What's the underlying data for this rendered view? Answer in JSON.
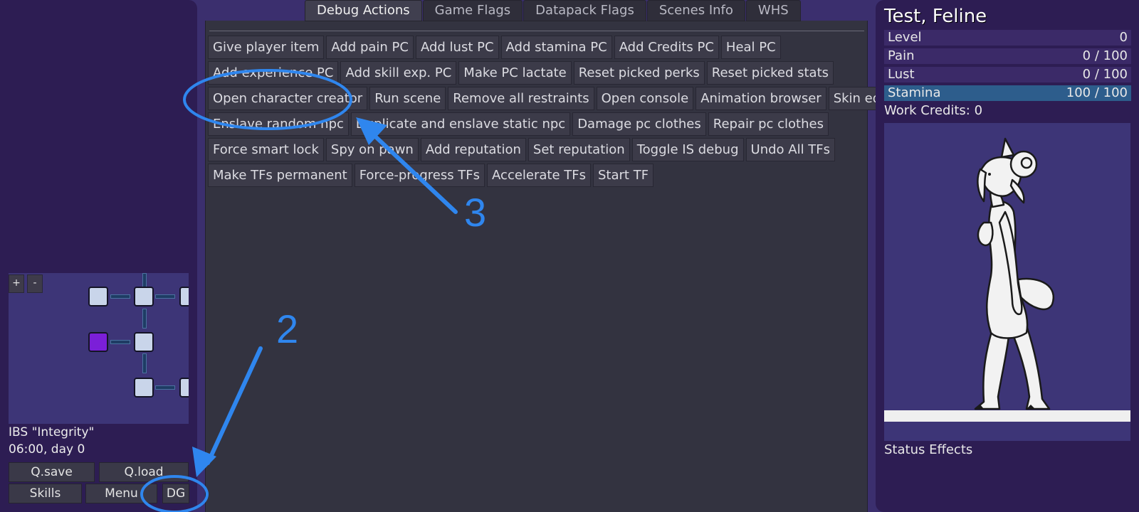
{
  "tabs": [
    "Debug Actions",
    "Game Flags",
    "Datapack Flags",
    "Scenes Info",
    "WHS"
  ],
  "action_rows": [
    [
      "Give player item",
      "Add pain PC",
      "Add lust PC",
      "Add stamina PC",
      "Add Credits PC",
      "Heal PC"
    ],
    [
      "Add experience PC",
      "Add skill exp. PC",
      "Make PC lactate",
      "Reset picked perks",
      "Reset picked stats"
    ],
    [
      "Open character creator",
      "Run scene",
      "Remove all restraints",
      "Open console",
      "Animation browser",
      "Skin editor"
    ],
    [
      "Enslave random npc",
      "Duplicate and enslave static npc",
      "Damage pc clothes",
      "Repair pc clothes"
    ],
    [
      "Force smart lock",
      "Spy on pawn",
      "Add reputation",
      "Set reputation",
      "Toggle IS debug",
      "Undo All TFs"
    ],
    [
      "Make TFs permanent",
      "Force-progress TFs",
      "Accelerate TFs",
      "Start TF"
    ]
  ],
  "minimap": {
    "zoom_in": "+",
    "zoom_out": "-"
  },
  "location": {
    "name": "IBS \"Integrity\"",
    "time": "06:00, day 0"
  },
  "left_buttons": {
    "qsave": "Q.save",
    "qload": "Q.load",
    "skills": "Skills",
    "menu": "Menu",
    "dg": "DG"
  },
  "character": {
    "name": "Test, Feline",
    "stats": [
      {
        "label": "Level",
        "value": "0"
      },
      {
        "label": "Pain",
        "value": "0 / 100"
      },
      {
        "label": "Lust",
        "value": "0 / 100"
      },
      {
        "label": "Stamina",
        "value": "100 / 100"
      }
    ],
    "credits": "Work Credits: 0",
    "status_effects": "Status Effects"
  },
  "annotations": {
    "label_2": "2",
    "label_3": "3"
  },
  "colors": {
    "annotation": "#2f86ee",
    "current_room": "#7b1fd8",
    "stamina_bar": "#2d5d8c"
  }
}
